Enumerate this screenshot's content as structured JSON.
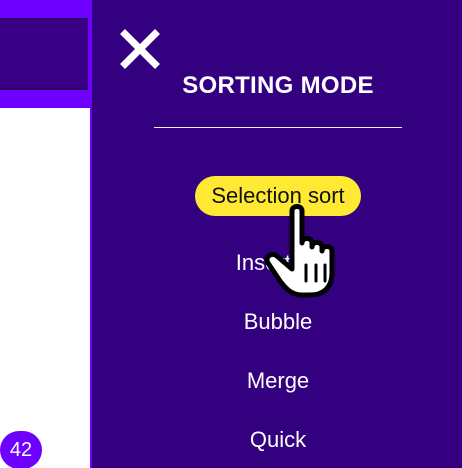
{
  "background_app": {
    "badge_count": "42"
  },
  "drawer": {
    "title": "SORTING MODE",
    "items": [
      {
        "label": "Selection sort",
        "selected": true
      },
      {
        "label": "Insertion",
        "selected": false
      },
      {
        "label": "Bubble",
        "selected": false
      },
      {
        "label": "Merge",
        "selected": false
      },
      {
        "label": "Quick",
        "selected": false
      }
    ]
  },
  "icons": {
    "close": "close-icon",
    "cursor": "pointer-hand-icon"
  },
  "colors": {
    "drawer_bg": "#330080",
    "accent_purple": "#6d00ff",
    "selected_bg": "#ffe933",
    "text": "#ffffff"
  }
}
